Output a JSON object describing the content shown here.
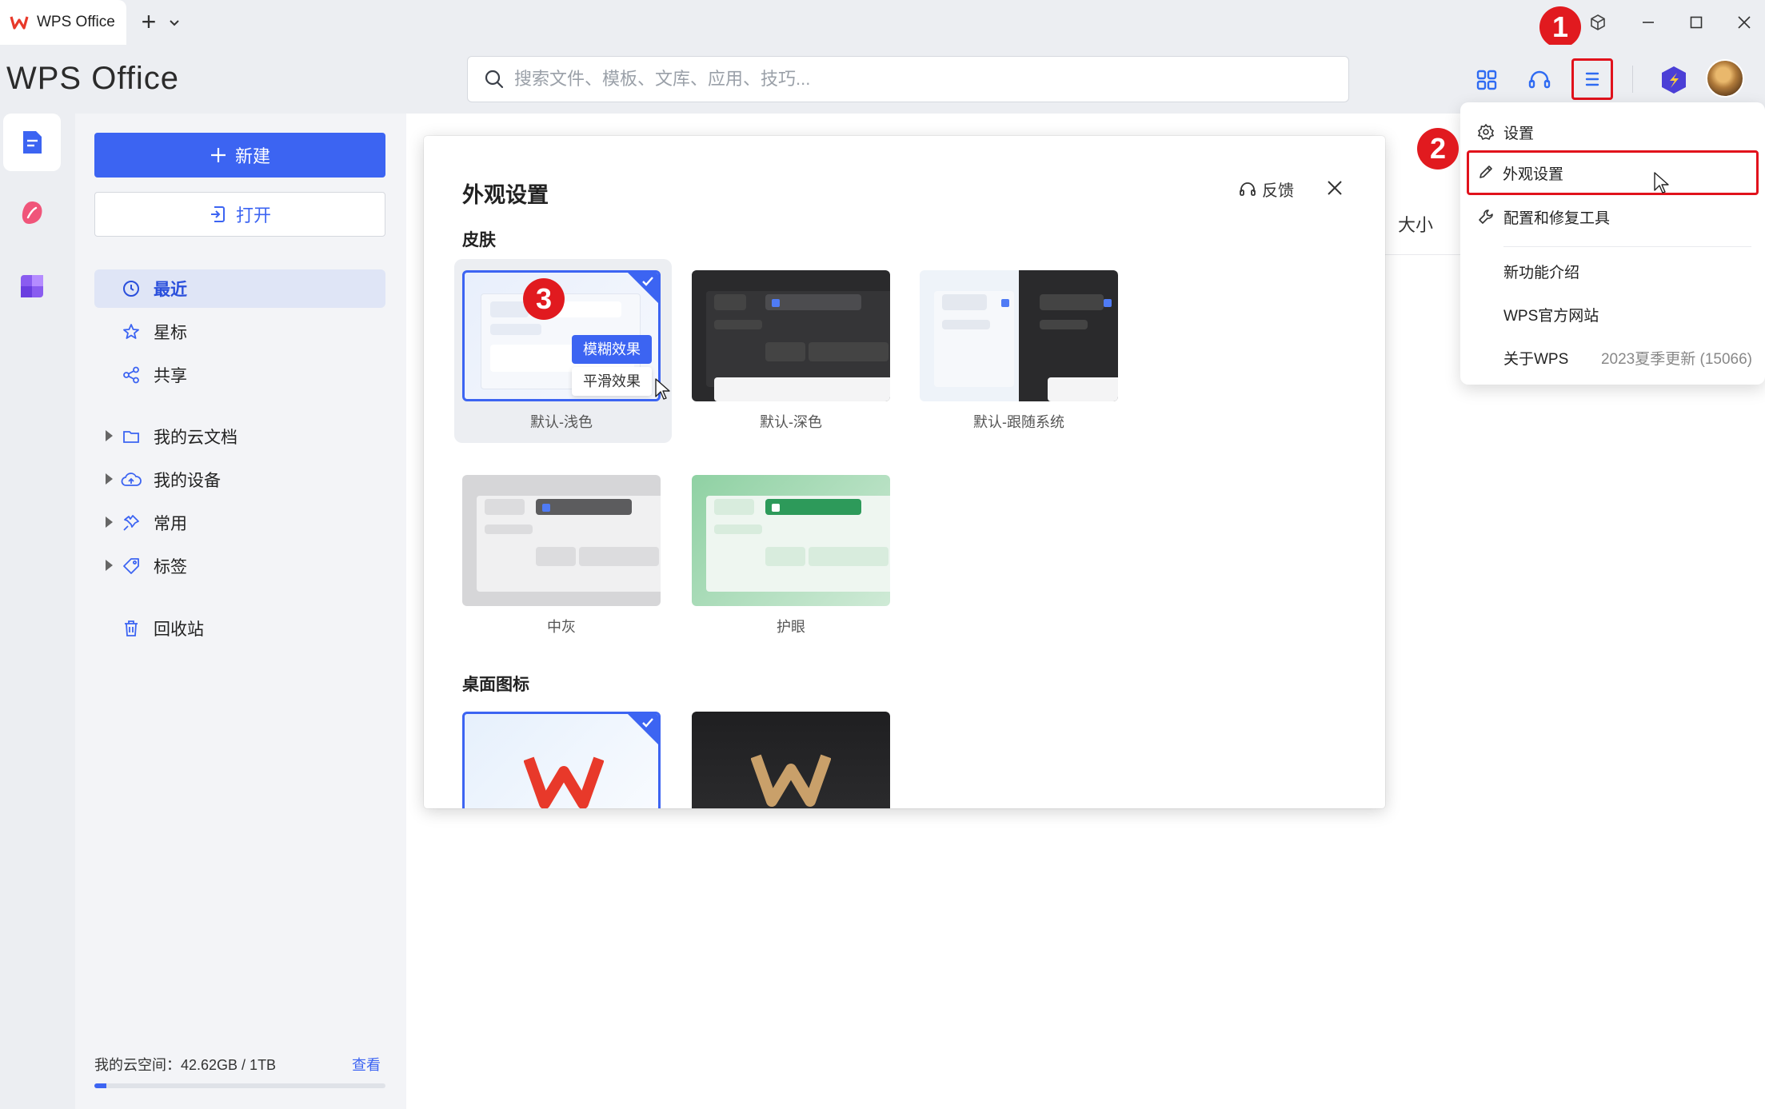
{
  "titlebar": {
    "tab_title": "WPS Office",
    "add_tab": "+"
  },
  "header": {
    "brand": "WPS Office",
    "search_placeholder": "搜索文件、模板、文库、应用、技巧..."
  },
  "annotations": [
    "1",
    "2",
    "3"
  ],
  "sidebar": {
    "new_label": "新建",
    "open_label": "打开",
    "nav": [
      {
        "label": "最近",
        "icon": "clock-icon",
        "active": true
      },
      {
        "label": "星标",
        "icon": "star-icon"
      },
      {
        "label": "共享",
        "icon": "share-icon"
      }
    ],
    "tree": [
      {
        "label": "我的云文档",
        "icon": "folder-icon"
      },
      {
        "label": "我的设备",
        "icon": "cloud-device-icon"
      },
      {
        "label": "常用",
        "icon": "pin-icon"
      },
      {
        "label": "标签",
        "icon": "tag-icon"
      }
    ],
    "trash": "回收站",
    "storage_label": "我的云空间：42.62GB / 1TB",
    "storage_view": "查看",
    "storage_fraction": 0.042
  },
  "main": {
    "size_column": "大小"
  },
  "dialog": {
    "title": "外观设置",
    "feedback": "反馈",
    "skin_section": "皮肤",
    "skins": [
      {
        "label": "默认-浅色",
        "selected": true
      },
      {
        "label": "默认-深色"
      },
      {
        "label": "默认-跟随系统"
      },
      {
        "label": "中灰"
      },
      {
        "label": "护眼"
      }
    ],
    "blur_option": "模糊效果",
    "smooth_option": "平滑效果",
    "icon_section": "桌面图标"
  },
  "dropdown": {
    "items": [
      {
        "label": "设置",
        "icon": "gear-icon"
      },
      {
        "label": "外观设置",
        "icon": "brush-icon"
      },
      {
        "label": "配置和修复工具",
        "icon": "wrench-icon"
      },
      {
        "label": "新功能介绍"
      },
      {
        "label": "WPS官方网站"
      },
      {
        "label": "关于WPS",
        "version": "2023夏季更新 (15066)"
      }
    ]
  },
  "colors": {
    "accent": "#3c64f2",
    "annotation": "#e11a1f",
    "brand_red": "#e8392a"
  }
}
